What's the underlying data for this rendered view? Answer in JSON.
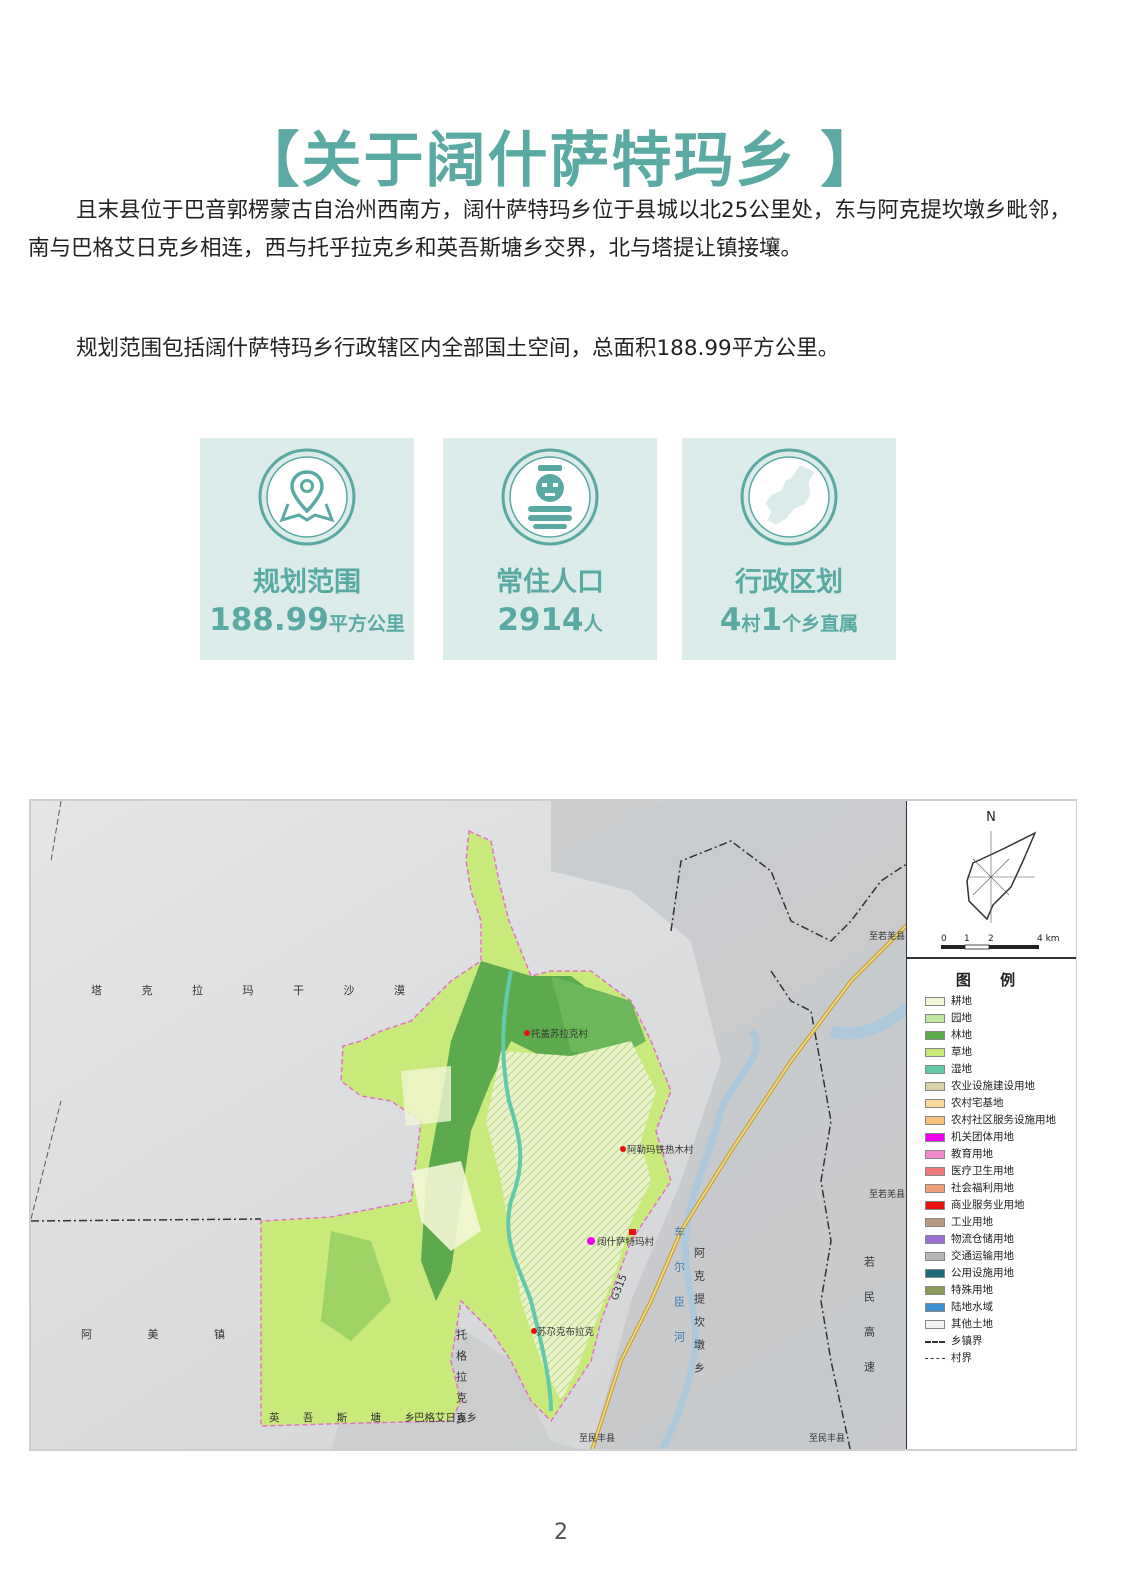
{
  "title": "【关于阔什萨特玛乡 】",
  "paragraphs": {
    "p1": "且末县位于巴音郭楞蒙古自治州西南方，阔什萨特玛乡位于县城以北25公里处，东与阿克提坎墩乡毗邻，南与巴格艾日克乡相连，西与托乎拉克乡和英吾斯塘乡交界，北与塔提让镇接壤。",
    "p2": "规划范围包括阔什萨特玛乡行政辖区内全部国土空间，总面积188.99平方公里。"
  },
  "cards": [
    {
      "icon": "map-pin-icon",
      "label": "规划范围",
      "value_main": "188.99",
      "value_unit": "平方公里"
    },
    {
      "icon": "person-icon",
      "label": "常住人口",
      "value_main": "2914",
      "value_unit": "人"
    },
    {
      "icon": "region-map-icon",
      "label": "行政区划",
      "value_num1": "4",
      "value_unit1": "村",
      "value_num2": "1",
      "value_unit2": "个乡直属"
    }
  ],
  "map": {
    "labels": {
      "desert": "塔 克 拉 玛 干 沙 漠",
      "amei": "阿 美 镇",
      "yingwu": "英 吾 斯 塘 乡",
      "bageai": "巴格艾日克乡",
      "tuohula": "托格拉克乡",
      "akeleft": "阿克提坎墩乡",
      "chaer": "车尔臣河",
      "ruomin": "若民高速",
      "village1": "托盖苏拉克村",
      "village2": "阿勒玛铁热木村",
      "village3": "阔什萨特玛村",
      "village4": "苏尕克布拉克",
      "road": "G315",
      "to_ruoqiang": "至若羌县",
      "to_ruoqiang2": "至若羌县",
      "to_minfeng": "至民丰县",
      "to_minfeng2": "至民丰县"
    },
    "north": "N",
    "scale": {
      "t0": "0",
      "t1": "1",
      "t2": "2",
      "t4": "4 km"
    },
    "legend_title": "图 例",
    "legend": [
      {
        "label": "耕地",
        "color": "#f3f6d6"
      },
      {
        "label": "园地",
        "color": "#bfe6a3"
      },
      {
        "label": "林地",
        "color": "#5da94e"
      },
      {
        "label": "草地",
        "color": "#c8ea7a"
      },
      {
        "label": "湿地",
        "color": "#62c9a9"
      },
      {
        "label": "农业设施建设用地",
        "color": "#d9d3a6"
      },
      {
        "label": "农村宅基地",
        "color": "#f7d79a"
      },
      {
        "label": "农村社区服务设施用地",
        "color": "#f6c27a"
      },
      {
        "label": "机关团体用地",
        "color": "#f000f0"
      },
      {
        "label": "教育用地",
        "color": "#f28ad0"
      },
      {
        "label": "医疗卫生用地",
        "color": "#f07a7a"
      },
      {
        "label": "社会福利用地",
        "color": "#f29f7c"
      },
      {
        "label": "商业服务业用地",
        "color": "#e81010"
      },
      {
        "label": "工业用地",
        "color": "#b99a80"
      },
      {
        "label": "物流仓储用地",
        "color": "#9b6fd6"
      },
      {
        "label": "交通运输用地",
        "color": "#b8b8b8"
      },
      {
        "label": "公用设施用地",
        "color": "#1c6a7c"
      },
      {
        "label": "特殊用地",
        "color": "#8a9a5a"
      },
      {
        "label": "陆地水域",
        "color": "#3c8fd0"
      },
      {
        "label": "其他土地",
        "color": "#f4f4f4"
      }
    ],
    "legend_lines": [
      {
        "label": "乡镇界",
        "style": "dash-dot"
      },
      {
        "label": "村界",
        "style": "dashed"
      }
    ]
  },
  "page_number": "2"
}
